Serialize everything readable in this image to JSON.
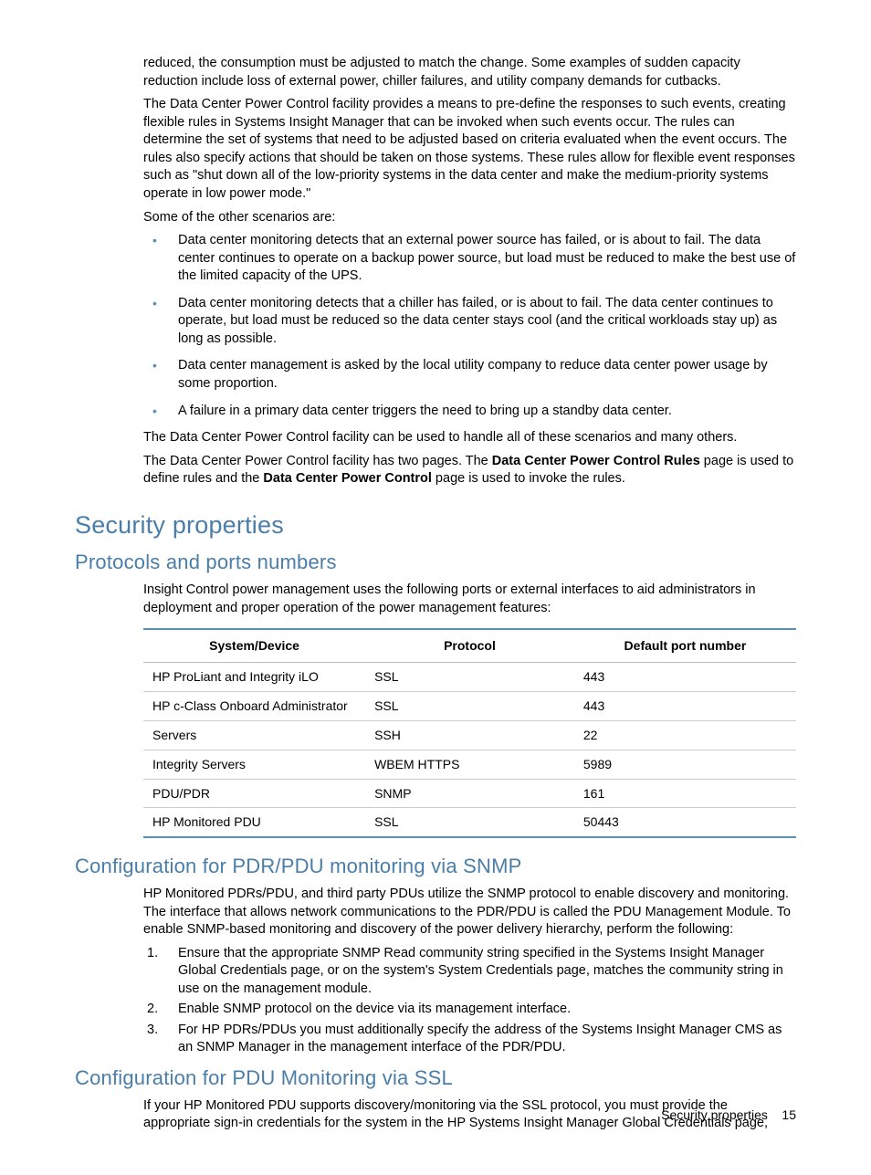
{
  "intro": {
    "p1": "reduced, the consumption must be adjusted to match the change. Some examples of sudden capacity reduction include loss of external power, chiller failures, and utility company demands for cutbacks.",
    "p2": "The Data Center Power Control facility provides a means to pre-define the responses to such events, creating flexible rules in Systems Insight Manager that can be invoked when such events occur. The rules can determine the set of systems that need to be adjusted based on criteria evaluated when the event occurs. The rules also specify actions that should be taken on those systems. These rules allow for flexible event responses such as \"shut down all of the low-priority systems in the data center and make the medium-priority systems operate in low power mode.\"",
    "p3": "Some of the other scenarios are:",
    "bullets": [
      "Data center monitoring detects that an external power source has failed, or is about to fail. The data center continues to operate on a backup power source, but load must be reduced to make the best use of the limited capacity of the UPS.",
      "Data center monitoring detects that a chiller has failed, or is about to fail. The data center continues to operate, but load must be reduced so the data center stays cool (and the critical workloads stay up) as long as possible.",
      "Data center management is asked by the local utility company to reduce data center power usage by some proportion.",
      "A failure in a primary data center triggers the need to bring up a standby data center."
    ],
    "p4": "The Data Center Power Control facility can be used to handle all of these scenarios and many others.",
    "p5a": "The Data Center Power Control facility has two pages. The ",
    "p5b": "Data Center Power Control Rules",
    "p5c": " page is used to define rules and the ",
    "p5d": "Data Center Power Control",
    "p5e": " page is used to invoke the rules."
  },
  "security": {
    "heading": "Security properties",
    "protocols": {
      "heading": "Protocols and ports numbers",
      "intro": "Insight Control power management uses the following ports or external interfaces to aid administrators in deployment and proper operation of the power management features:",
      "table": {
        "headers": [
          "System/Device",
          "Protocol",
          "Default port number"
        ],
        "rows": [
          [
            "HP ProLiant and Integrity iLO",
            "SSL",
            "443"
          ],
          [
            "HP c-Class Onboard Administrator",
            "SSL",
            "443"
          ],
          [
            "Servers",
            "SSH",
            "22"
          ],
          [
            "Integrity Servers",
            "WBEM HTTPS",
            "5989"
          ],
          [
            "PDU/PDR",
            "SNMP",
            "161"
          ],
          [
            "HP Monitored PDU",
            "SSL",
            "50443"
          ]
        ]
      }
    },
    "snmp": {
      "heading": "Configuration for PDR/PDU monitoring via SNMP",
      "intro": "HP Monitored PDRs/PDU, and third party PDUs utilize the SNMP protocol to enable discovery and monitoring. The interface that allows network communications to the PDR/PDU is called the PDU Management Module. To enable SNMP-based monitoring and discovery of the power delivery hierarchy, perform the following:",
      "steps": [
        "Ensure that the appropriate SNMP Read community string specified in the Systems Insight Manager Global Credentials page, or on the system's System Credentials page, matches the community string in use on the management module.",
        "Enable SNMP protocol on the device via its management interface.",
        "For HP PDRs/PDUs you must additionally specify the address of the Systems Insight Manager CMS as an SNMP Manager in the management interface of the PDR/PDU."
      ]
    },
    "ssl": {
      "heading": "Configuration for PDU Monitoring via SSL",
      "intro": "If your HP Monitored PDU supports discovery/monitoring via the SSL protocol, you must provide the appropriate sign-in credentials for the system in the HP Systems Insight Manager Global Credentials page,"
    }
  },
  "footer": {
    "label": "Security properties",
    "page": "15"
  }
}
